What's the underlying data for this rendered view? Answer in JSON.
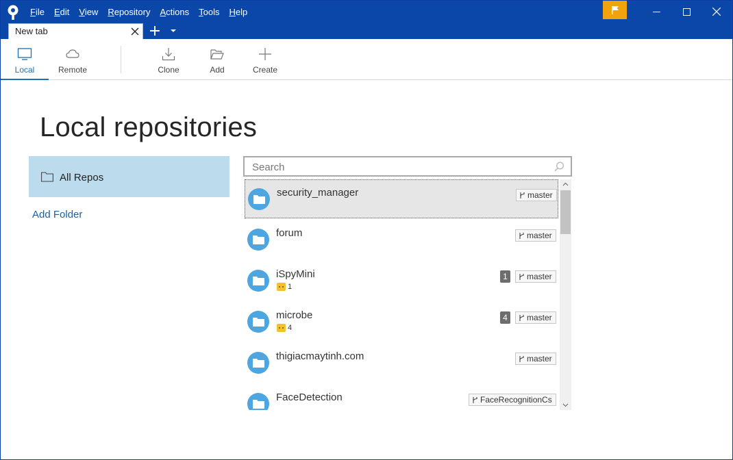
{
  "menu": [
    {
      "mnemonic": "F",
      "rest": "ile"
    },
    {
      "mnemonic": "E",
      "rest": "dit"
    },
    {
      "mnemonic": "V",
      "rest": "iew"
    },
    {
      "mnemonic": "R",
      "rest": "epository"
    },
    {
      "mnemonic": "A",
      "rest": "ctions"
    },
    {
      "mnemonic": "T",
      "rest": "ools"
    },
    {
      "mnemonic": "H",
      "rest": "elp"
    }
  ],
  "tabs": [
    {
      "label": "New tab"
    }
  ],
  "toolbar": {
    "local": "Local",
    "remote": "Remote",
    "clone": "Clone",
    "add": "Add",
    "create": "Create"
  },
  "main": {
    "title": "Local repositories",
    "sidebar_all": "All Repos",
    "add_folder": "Add Folder",
    "search_placeholder": "Search"
  },
  "repos": [
    {
      "name": "security_manager",
      "branch": "master",
      "count": null,
      "changes": null,
      "selected": true
    },
    {
      "name": "forum",
      "branch": "master",
      "count": null,
      "changes": null,
      "selected": false
    },
    {
      "name": "iSpyMini",
      "branch": "master",
      "count": "1",
      "changes": "1",
      "selected": false
    },
    {
      "name": "microbe",
      "branch": "master",
      "count": "4",
      "changes": "4",
      "selected": false
    },
    {
      "name": "thigiacmaytinh.com",
      "branch": "master",
      "count": null,
      "changes": null,
      "selected": false
    },
    {
      "name": "FaceDetection",
      "branch": "FaceRecognitionCs",
      "count": null,
      "changes": null,
      "selected": false
    }
  ],
  "colors": {
    "titlebar": "#0b47a8",
    "accent": "#1a6fb5",
    "flag": "#f0a30a",
    "sidebar_selected": "#bcdcee",
    "repo_avatar": "#4ea6e0"
  }
}
